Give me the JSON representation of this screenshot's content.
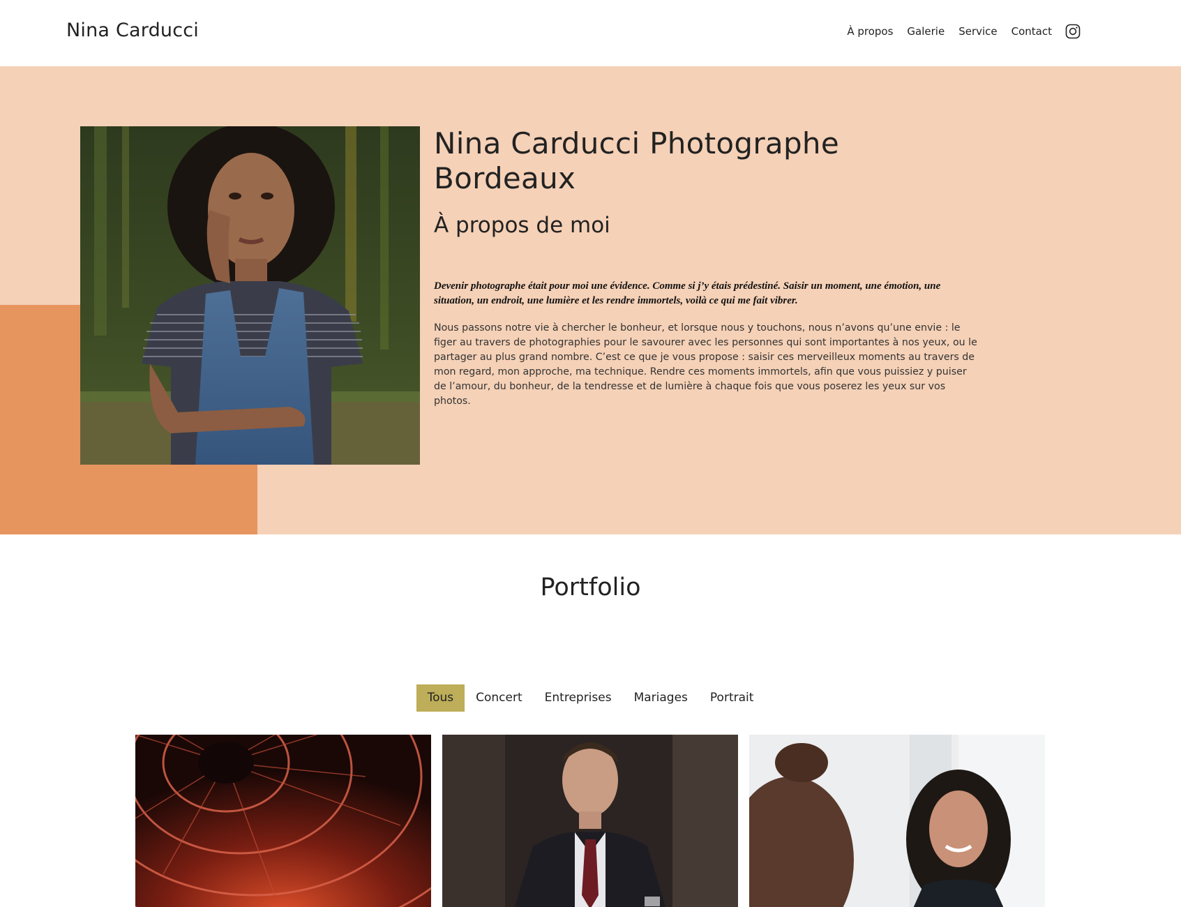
{
  "header": {
    "brand": "Nina Carducci",
    "nav": [
      {
        "label": "À propos"
      },
      {
        "label": "Galerie"
      },
      {
        "label": "Service"
      },
      {
        "label": "Contact"
      }
    ],
    "instagram_icon": "instagram-icon"
  },
  "about": {
    "title": "Nina Carducci Photographe Bordeaux",
    "subtitle": "À propos de moi",
    "quote": "Devenir photographe était pour moi une évidence. Comme si j’y étais prédestiné. Saisir un moment, une émotion, une situation, un endroit, une lumière et les rendre immortels, voilà ce qui me fait vibrer.",
    "body": "Nous passons notre vie à chercher le bonheur, et lorsque nous y touchons, nous n’avons qu’une envie : le figer au travers de photographies pour le savourer avec les personnes qui sont importantes à nos yeux, ou le partager au plus grand nombre. C’est ce que je vous propose : saisir ces merveilleux moments au travers de mon regard, mon approche, ma technique. Rendre ces moments immortels, afin que vous puissiez y puiser de l’amour, du bonheur, de la tendresse et de lumière à chaque fois que vous poserez les yeux sur vos photos."
  },
  "portfolio": {
    "title": "Portfolio",
    "filters": [
      {
        "label": "Tous",
        "active": true
      },
      {
        "label": "Concert",
        "active": false
      },
      {
        "label": "Entreprises",
        "active": false
      },
      {
        "label": "Mariages",
        "active": false
      },
      {
        "label": "Portrait",
        "active": false
      }
    ]
  },
  "colors": {
    "about_bg": "#f5d1b7",
    "accent_block": "#e7955f",
    "filter_active": "#bead59"
  }
}
